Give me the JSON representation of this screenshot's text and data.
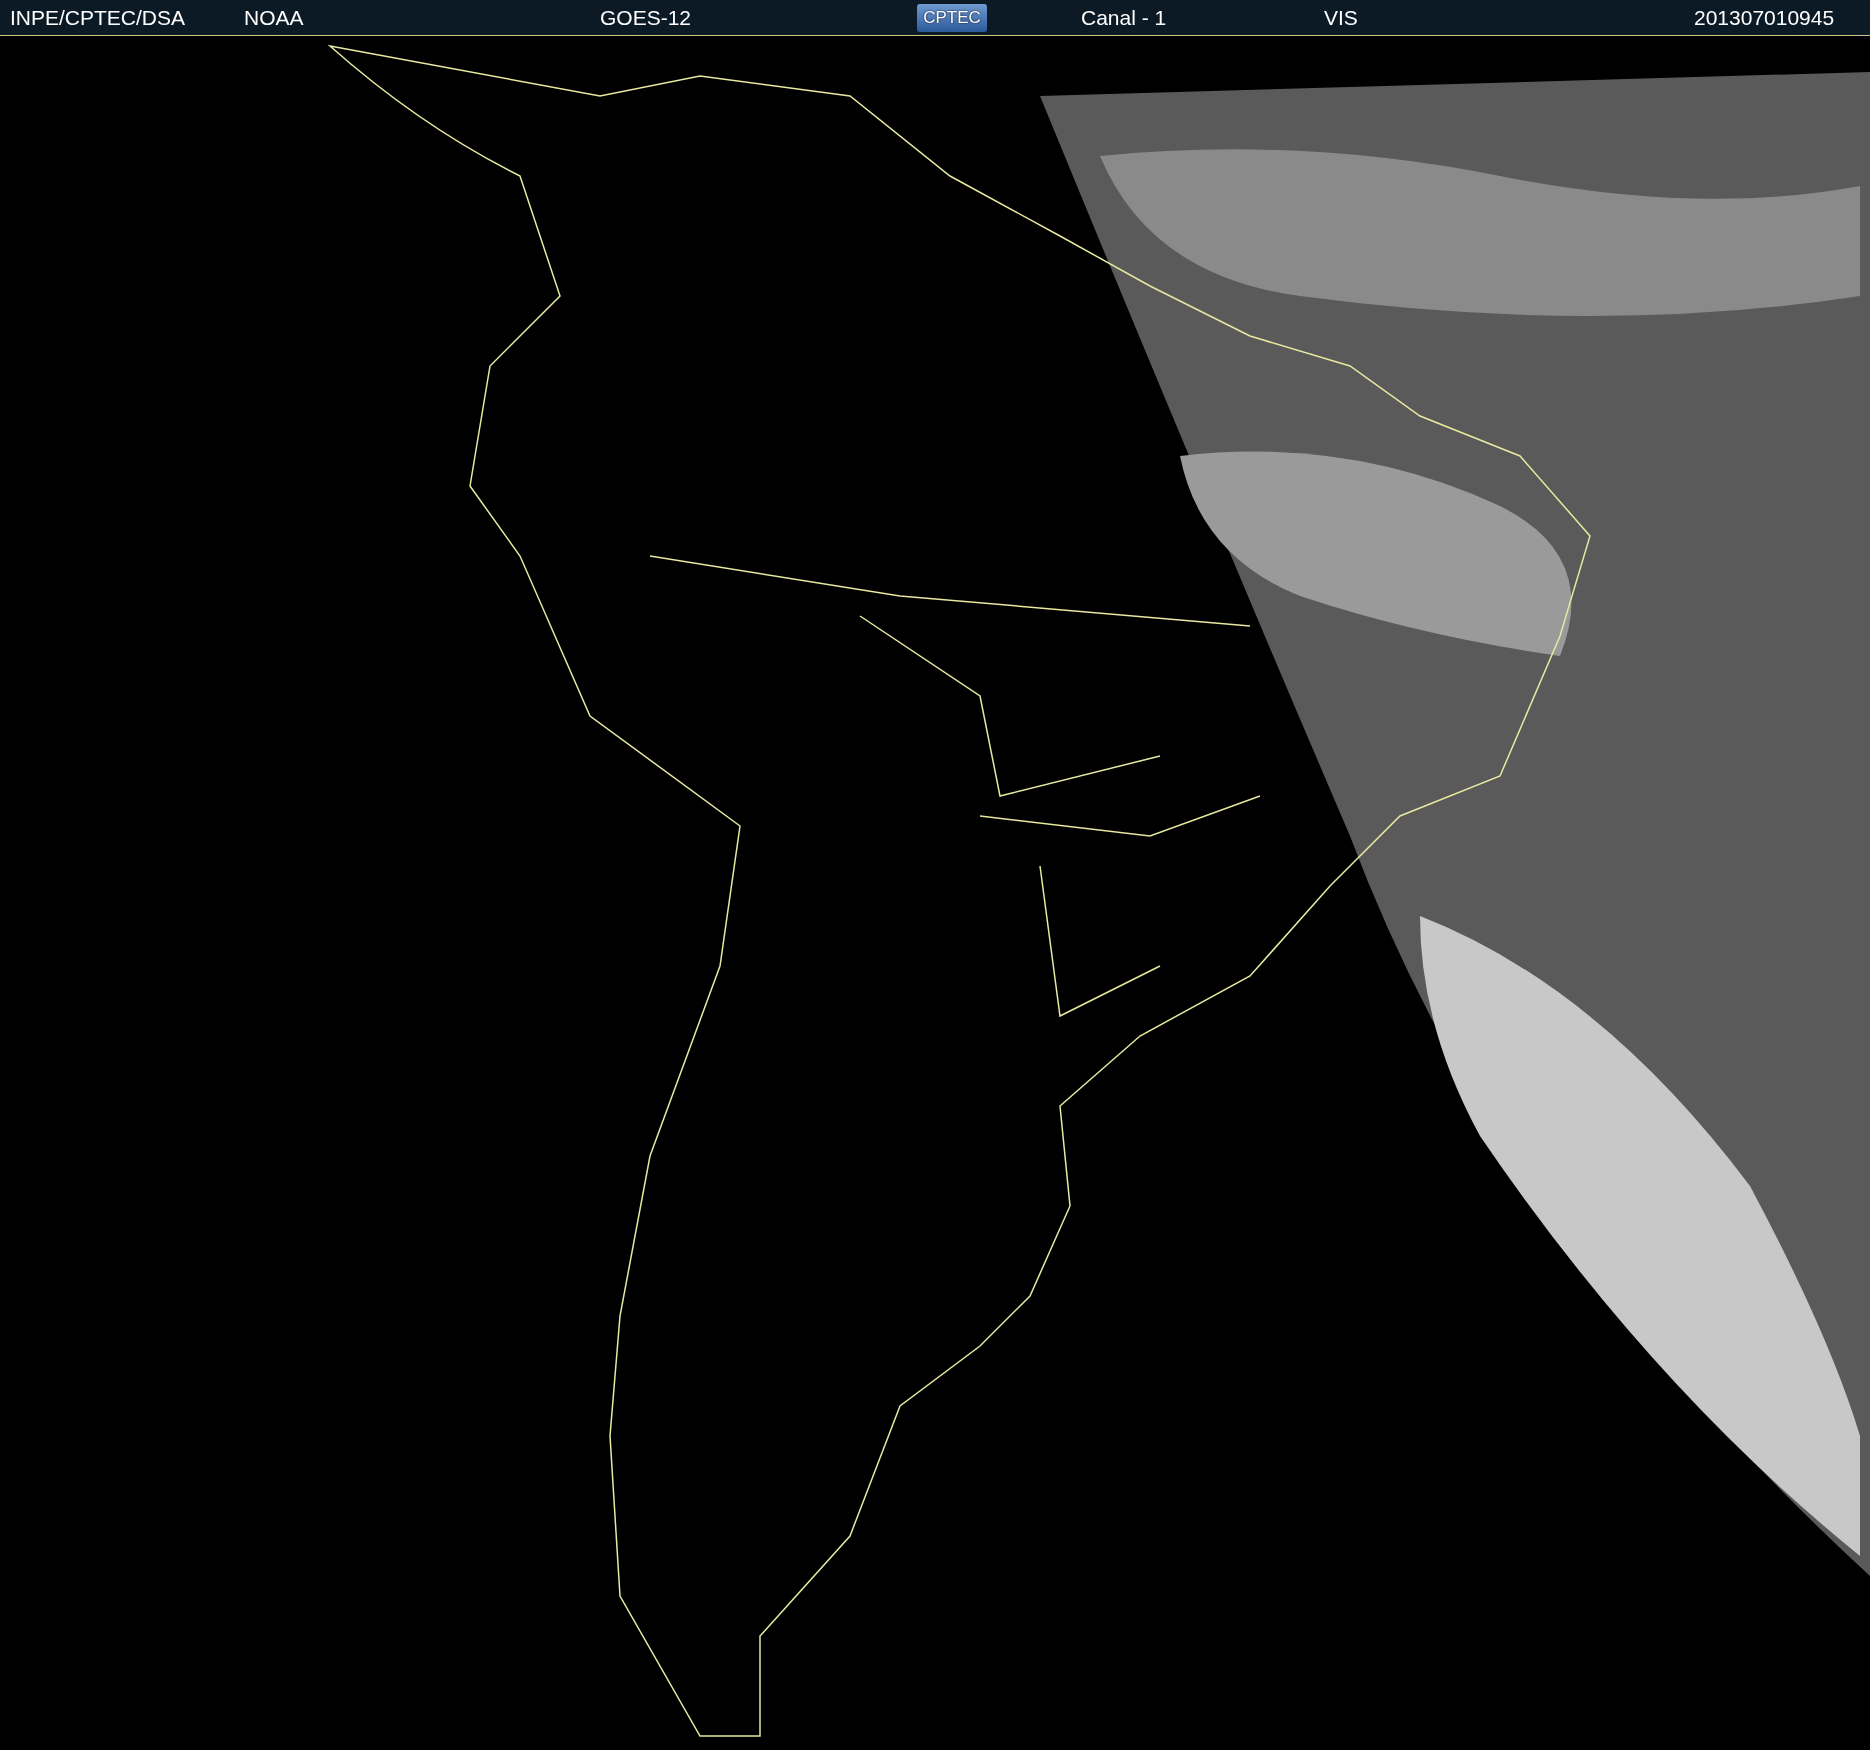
{
  "header": {
    "source": "INPE/CPTEC/DSA",
    "agency": "NOAA",
    "satellite": "GOES-12",
    "logo": "CPTEC",
    "channel": "Canal - 1",
    "band": "VIS",
    "timestamp": "201307010945"
  }
}
